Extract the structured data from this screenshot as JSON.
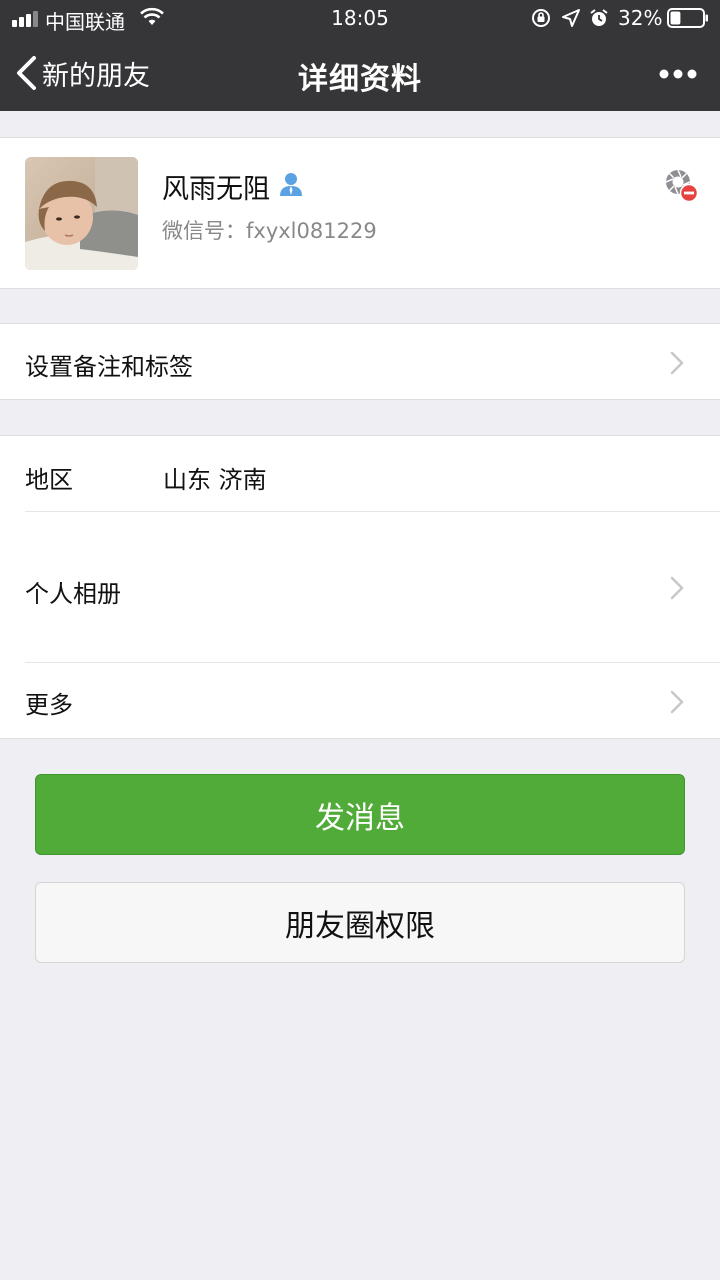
{
  "status_bar": {
    "carrier": "中国联通",
    "time": "18:05",
    "battery": "32%",
    "battery_level": 0.32
  },
  "nav": {
    "back_label": "新的朋友",
    "title": "详细资料"
  },
  "profile": {
    "nickname": "风雨无阻",
    "wechat_id_label": "微信号：",
    "wechat_id": "fxyxl081229"
  },
  "rows": {
    "remark_tags": "设置备注和标签",
    "region_label": "地区",
    "region_value": "山东 济南",
    "album": "个人相册",
    "more": "更多"
  },
  "buttons": {
    "send_message": "发消息",
    "moments_permission": "朋友圈权限"
  },
  "colors": {
    "nav_bg": "#363639",
    "primary_green": "#51ab39",
    "page_bg": "#eeeef3",
    "contact_icon_blue": "#5aa2e2",
    "blocked_red": "#e64340"
  },
  "icons": [
    "signal-icon",
    "wifi-icon",
    "orientation-lock-icon",
    "location-icon",
    "alarm-icon",
    "battery-icon",
    "back-chevron-icon",
    "more-dots-icon",
    "contact-person-icon",
    "moments-blocked-icon",
    "chevron-right-icon"
  ]
}
